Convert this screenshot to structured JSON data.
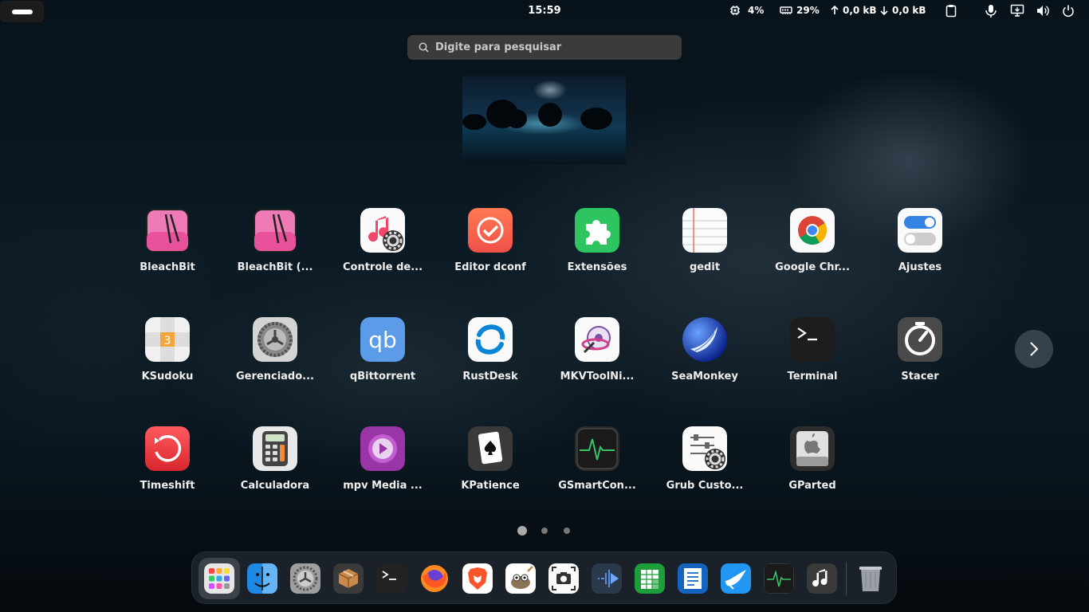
{
  "topbar": {
    "clock": "15:59",
    "cpu": "4%",
    "ram": "29%",
    "net_up": "0,0 kB",
    "net_down": "0,0 kB"
  },
  "search": {
    "placeholder": "Digite para pesquisar"
  },
  "apps": [
    {
      "label": "BleachBit",
      "icon": "bleachbit-icon"
    },
    {
      "label": "BleachBit (...",
      "icon": "bleachbit-root-icon"
    },
    {
      "label": "Controle de...",
      "icon": "music-settings-icon"
    },
    {
      "label": "Editor dconf",
      "icon": "dconf-icon"
    },
    {
      "label": "Extensões",
      "icon": "puzzle-icon"
    },
    {
      "label": "gedit",
      "icon": "notepad-icon"
    },
    {
      "label": "Google Chr...",
      "icon": "chrome-icon"
    },
    {
      "label": "Ajustes",
      "icon": "toggle-icon"
    },
    {
      "label": "KSudoku",
      "icon": "sudoku-icon"
    },
    {
      "label": "Gerenciado...",
      "icon": "gear-icon"
    },
    {
      "label": "qBittorrent",
      "icon": "qbittorrent-icon"
    },
    {
      "label": "RustDesk",
      "icon": "rustdesk-icon"
    },
    {
      "label": "MKVToolNi...",
      "icon": "mkvtoolnix-icon"
    },
    {
      "label": "SeaMonkey",
      "icon": "seamonkey-icon"
    },
    {
      "label": "Terminal",
      "icon": "terminal-icon"
    },
    {
      "label": "Stacer",
      "icon": "stacer-icon"
    },
    {
      "label": "Timeshift",
      "icon": "timeshift-icon"
    },
    {
      "label": "Calculadora",
      "icon": "calculator-icon"
    },
    {
      "label": "mpv Media ...",
      "icon": "mpv-icon"
    },
    {
      "label": "KPatience",
      "icon": "cards-icon"
    },
    {
      "label": "GSmartCon...",
      "icon": "monitor-icon"
    },
    {
      "label": "Grub Custo...",
      "icon": "grub-icon"
    },
    {
      "label": "GParted",
      "icon": "gparted-icon"
    }
  ],
  "pages": {
    "count": 3,
    "current": 0
  },
  "dock": [
    "app-grid-icon",
    "finder-icon",
    "settings-icon",
    "package-icon",
    "terminal-icon",
    "firefox-icon",
    "brave-icon",
    "gimp-icon",
    "screenshot-icon",
    "kdenlive-icon",
    "spreadsheet-icon",
    "writer-icon",
    "bird-icon",
    "system-monitor-icon",
    "music-icon",
    "trash-icon"
  ],
  "colors": {
    "panel_bg": "#3b3b3b",
    "accent": "#3584e4"
  }
}
